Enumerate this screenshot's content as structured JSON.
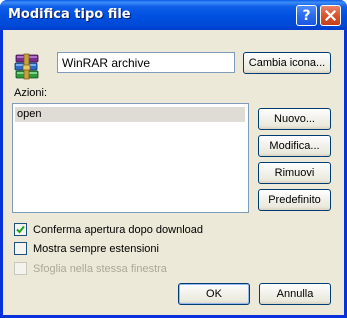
{
  "window": {
    "title": "Modifica tipo file",
    "help_glyph": "?",
    "close_glyph": "✕"
  },
  "file_type": {
    "icon": "winrar-archive-icon",
    "name": "WinRAR archive",
    "change_icon_label": "Cambia icona..."
  },
  "actions": {
    "label": "Azioni:",
    "items": [
      "open"
    ],
    "selected_index": 0,
    "buttons": {
      "new": "Nuovo...",
      "edit": "Modifica...",
      "remove": "Rimuovi",
      "default": "Predefinito"
    }
  },
  "options": [
    {
      "label": "Conferma apertura dopo download",
      "checked": true,
      "enabled": true
    },
    {
      "label": "Mostra sempre estensioni",
      "checked": false,
      "enabled": true
    },
    {
      "label": "Sfoglia nella stessa finestra",
      "checked": false,
      "enabled": false
    }
  ],
  "footer": {
    "ok_label": "OK",
    "cancel_label": "Annulla"
  },
  "colors": {
    "titlebar": "#0054e3",
    "dialog_face": "#ece9d8",
    "close_button": "#d8552f",
    "checkmark": "#21a121"
  }
}
